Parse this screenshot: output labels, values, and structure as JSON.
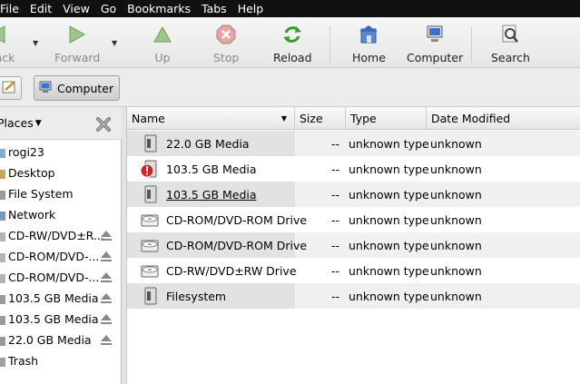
{
  "menubar": {
    "items": [
      "File",
      "Edit",
      "View",
      "Go",
      "Bookmarks",
      "Tabs",
      "Help"
    ]
  },
  "toolbar": {
    "back_label": "Back",
    "forward_label": "Forward",
    "up_label": "Up",
    "stop_label": "Stop",
    "reload_label": "Reload",
    "home_label": "Home",
    "computer_label": "Computer",
    "search_label": "Search"
  },
  "location": {
    "crumb_label": "Computer"
  },
  "sidebar": {
    "title": "Places",
    "items": [
      {
        "label": "rogi23",
        "icon": "home-folder-icon",
        "eject": false
      },
      {
        "label": "Desktop",
        "icon": "desktop-icon",
        "eject": false
      },
      {
        "label": "File System",
        "icon": "drive-icon",
        "eject": false
      },
      {
        "label": "Network",
        "icon": "network-icon",
        "eject": false
      },
      {
        "label": "CD-RW/DVD±R...",
        "icon": "optical-drive-icon",
        "eject": true
      },
      {
        "label": "CD-ROM/DVD-...",
        "icon": "optical-drive-icon",
        "eject": true
      },
      {
        "label": "CD-ROM/DVD-...",
        "icon": "optical-drive-icon",
        "eject": true
      },
      {
        "label": "103.5 GB Media",
        "icon": "drive-icon",
        "eject": true
      },
      {
        "label": "103.5 GB Media",
        "icon": "drive-icon",
        "eject": true
      },
      {
        "label": "22.0 GB Media",
        "icon": "drive-icon",
        "eject": true
      },
      {
        "label": "Trash",
        "icon": "trash-icon",
        "eject": false
      }
    ]
  },
  "filelist": {
    "columns": {
      "name": "Name",
      "size": "Size",
      "type": "Type",
      "date": "Date Modified"
    },
    "rows": [
      {
        "name": "22.0 GB Media",
        "icon": "drive-icon",
        "size": "--",
        "type": "unknown type",
        "date": "unknown"
      },
      {
        "name": "103.5 GB Media",
        "icon": "drive-warning-icon",
        "size": "--",
        "type": "unknown type",
        "date": "unknown"
      },
      {
        "name": "103.5 GB Media",
        "icon": "drive-icon",
        "size": "--",
        "type": "unknown type",
        "date": "unknown"
      },
      {
        "name": "CD-ROM/DVD-ROM Drive",
        "icon": "optical-drive-icon",
        "size": "--",
        "type": "unknown type",
        "date": "unknown"
      },
      {
        "name": "CD-ROM/DVD-ROM Drive",
        "icon": "optical-drive-icon",
        "size": "--",
        "type": "unknown type",
        "date": "unknown"
      },
      {
        "name": "CD-RW/DVD±RW Drive",
        "icon": "optical-drive-icon",
        "size": "--",
        "type": "unknown type",
        "date": "unknown"
      },
      {
        "name": "Filesystem",
        "icon": "drive-icon",
        "size": "--",
        "type": "unknown type",
        "date": "unknown"
      }
    ]
  }
}
